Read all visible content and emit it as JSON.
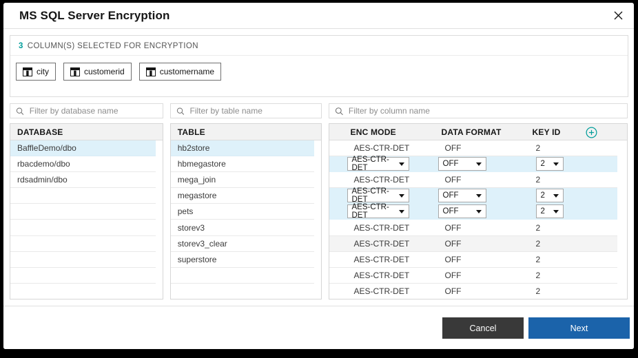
{
  "dialog": {
    "title": "MS SQL Server Encryption"
  },
  "summary": {
    "count": "3",
    "label": "COLUMN(S) SELECTED FOR ENCRYPTION",
    "chips": [
      "city",
      "customerid",
      "customername"
    ]
  },
  "filters": [
    {
      "name": "database",
      "placeholder": "Filter by database name"
    },
    {
      "name": "table",
      "placeholder": "Filter by table name"
    },
    {
      "name": "column",
      "placeholder": "Filter by column name"
    }
  ],
  "database_panel": {
    "header": "DATABASE",
    "items": [
      "BaffleDemo/dbo",
      "rbacdemo/dbo",
      "rdsadmin/dbo"
    ],
    "selected": "BaffleDemo/dbo",
    "empty_rows": 7
  },
  "table_panel": {
    "header": "TABLE",
    "items": [
      "hb2store",
      "hbmegastore",
      "mega_join",
      "megastore",
      "pets",
      "storev3",
      "storev3_clear",
      "superstore"
    ],
    "selected": "hb2store",
    "empty_rows": 2
  },
  "columns_panel": {
    "headers": {
      "enc_mode": "ENC MODE",
      "data_format": "DATA FORMAT",
      "key_id": "KEY ID"
    },
    "rows": [
      {
        "enc_mode": "AES-CTR-DET",
        "data_format": "OFF",
        "key_id": "2",
        "editable": false,
        "state": "default"
      },
      {
        "enc_mode": "AES-CTR-DET",
        "data_format": "OFF",
        "key_id": "2",
        "editable": true,
        "state": "selected"
      },
      {
        "enc_mode": "AES-CTR-DET",
        "data_format": "OFF",
        "key_id": "2",
        "editable": false,
        "state": "default"
      },
      {
        "enc_mode": "AES-CTR-DET",
        "data_format": "OFF",
        "key_id": "2",
        "editable": true,
        "state": "selected"
      },
      {
        "enc_mode": "AES-CTR-DET",
        "data_format": "OFF",
        "key_id": "2",
        "editable": true,
        "state": "selected"
      },
      {
        "enc_mode": "AES-CTR-DET",
        "data_format": "OFF",
        "key_id": "2",
        "editable": false,
        "state": "default"
      },
      {
        "enc_mode": "AES-CTR-DET",
        "data_format": "OFF",
        "key_id": "2",
        "editable": false,
        "state": "hover"
      },
      {
        "enc_mode": "AES-CTR-DET",
        "data_format": "OFF",
        "key_id": "2",
        "editable": false,
        "state": "default"
      },
      {
        "enc_mode": "AES-CTR-DET",
        "data_format": "OFF",
        "key_id": "2",
        "editable": false,
        "state": "default"
      },
      {
        "enc_mode": "AES-CTR-DET",
        "data_format": "OFF",
        "key_id": "2",
        "editable": false,
        "state": "default"
      }
    ]
  },
  "footer": {
    "cancel_label": "Cancel",
    "next_label": "Next"
  },
  "colors": {
    "accent_teal": "#009d9a",
    "selected_row": "#def1fa",
    "hover_row": "#f4f4f4",
    "next_blue": "#1b63aa",
    "cancel_dark": "#393939"
  }
}
